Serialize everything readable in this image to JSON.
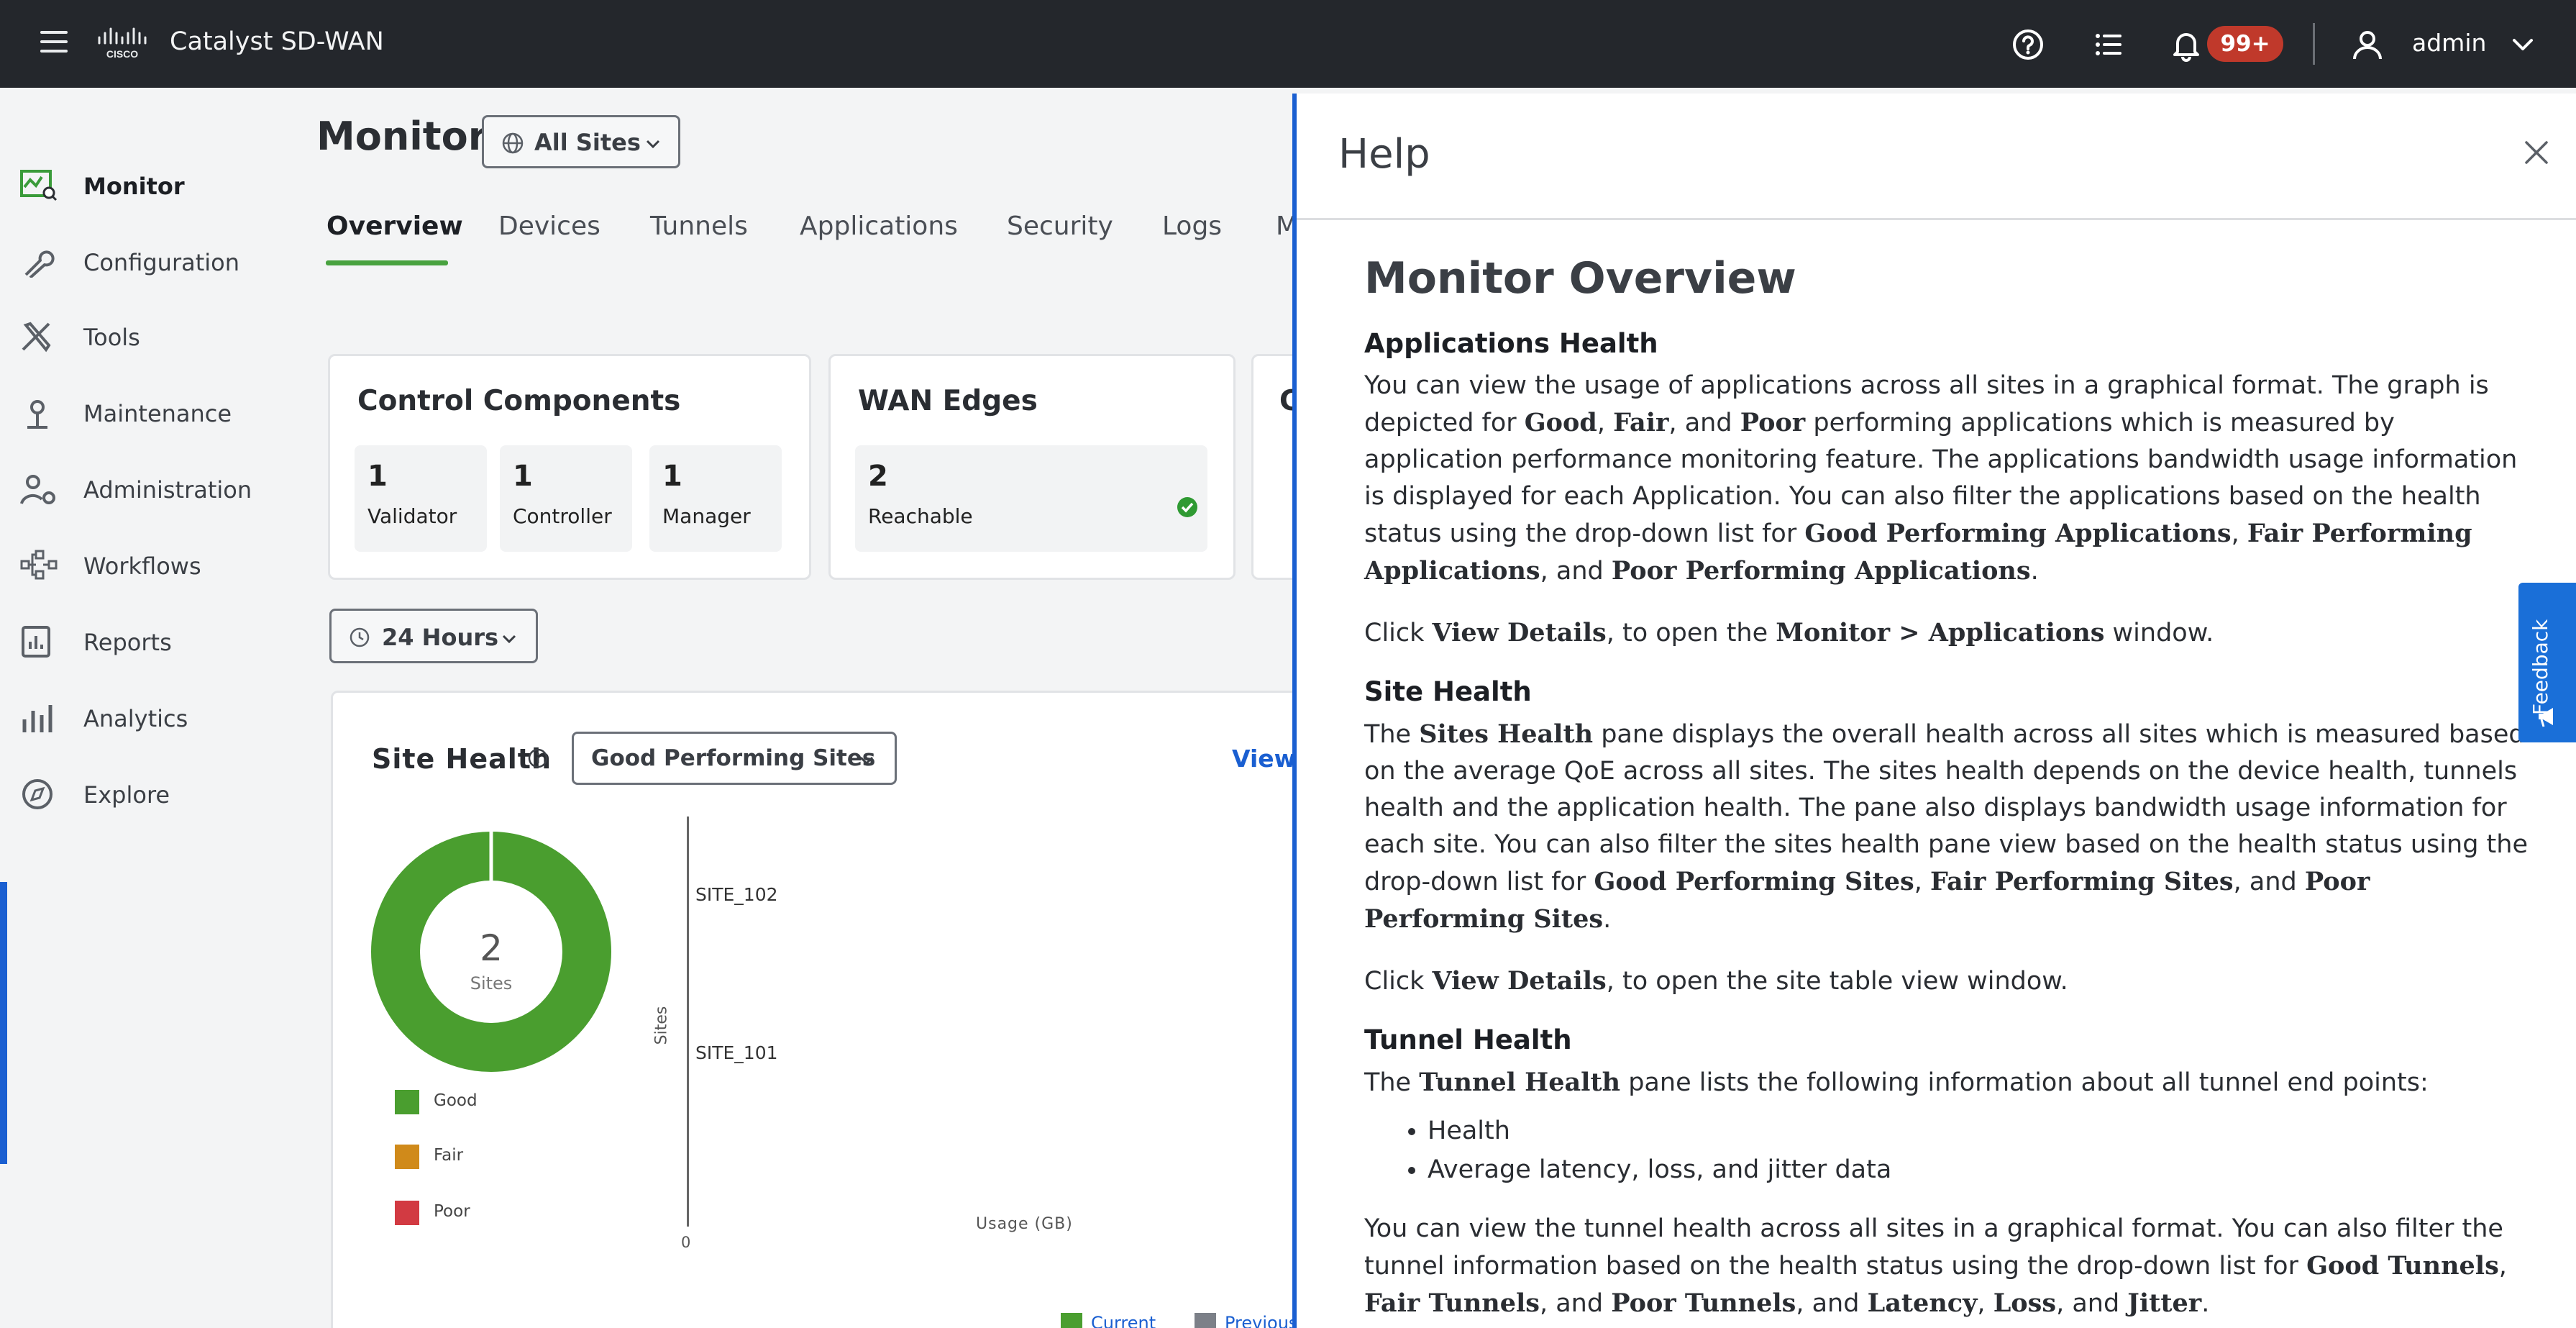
{
  "header": {
    "app_title": "Catalyst SD-WAN",
    "notifications_badge": "99+",
    "user_name": "admin"
  },
  "sidebar": {
    "items": [
      {
        "label": "Monitor",
        "icon": "monitor-icon"
      },
      {
        "label": "Configuration",
        "icon": "wrench-icon"
      },
      {
        "label": "Tools",
        "icon": "tools-icon"
      },
      {
        "label": "Maintenance",
        "icon": "maintenance-icon"
      },
      {
        "label": "Administration",
        "icon": "admin-user-gear-icon"
      },
      {
        "label": "Workflows",
        "icon": "workflows-icon"
      },
      {
        "label": "Reports",
        "icon": "reports-icon"
      },
      {
        "label": "Analytics",
        "icon": "bar-chart-icon"
      },
      {
        "label": "Explore",
        "icon": "compass-icon"
      }
    ]
  },
  "main": {
    "page_title": "Monitor",
    "site_filter": "All Sites",
    "tabs": [
      "Overview",
      "Devices",
      "Tunnels",
      "Applications",
      "Security",
      "Logs",
      "M"
    ],
    "control_components": {
      "title": "Control Components",
      "stats": [
        {
          "value": "1",
          "label": "Validator"
        },
        {
          "value": "1",
          "label": "Controller"
        },
        {
          "value": "1",
          "label": "Manager"
        }
      ]
    },
    "wan_edges": {
      "title": "WAN Edges",
      "value": "2",
      "label": "Reachable"
    },
    "third_card_title_fragment": "C",
    "time_filter": "24 Hours",
    "site_health": {
      "title": "Site Health",
      "filter": "Good Performing Sites",
      "view_link": "View D",
      "donut_value": "2",
      "donut_label": "Sites",
      "legend": [
        "Good",
        "Fair",
        "Poor"
      ],
      "colors": {
        "good": "#4a9e2f",
        "fair": "#d08a1a",
        "poor": "#d23a42"
      },
      "y_axis_label": "Sites",
      "x_axis_label": "Usage (GB)",
      "x_zero": "0",
      "sites": [
        "SITE_102",
        "SITE_101"
      ],
      "bottom_legend": [
        "Current",
        "Previous"
      ]
    }
  },
  "help": {
    "title": "Help",
    "heading": "Monitor Overview",
    "sections": {
      "apps_title": "Applications Health",
      "apps_p1_a": "You can view the usage of applications across all sites in a graphical format. The graph is depicted for ",
      "apps_good": "Good",
      "apps_sep1": ", ",
      "apps_fair": "Fair",
      "apps_sep2": ", and ",
      "apps_poor": "Poor",
      "apps_p1_b": " performing applications which is measured by application performance monitoring feature. The applications bandwidth usage information is displayed for each Application. You can also filter the applications based on the health status using the drop-down list for ",
      "apps_gpa": "Good Performing Applications",
      "apps_sep3": ", ",
      "apps_fpa": "Fair Performing Applications",
      "apps_sep4": ", and ",
      "apps_ppa": "Poor Performing Applications",
      "apps_end": ".",
      "apps_p2_a": "Click ",
      "apps_view": "View Details",
      "apps_p2_b": ", to open the ",
      "apps_window": "Monitor > Applications",
      "apps_p2_c": " window.",
      "site_title": "Site Health",
      "site_p1_a": "The ",
      "site_pane": "Sites Health",
      "site_p1_b": " pane displays the overall health across all sites which is measured based on the average QoE across all sites. The sites health depends on the device health, tunnels health and the application health. The pane also displays bandwidth usage information for each site. You can also filter the sites health pane view based on the health status using the drop-down list for ",
      "site_gps": "Good Performing Sites",
      "site_sep1": ", ",
      "site_fps": "Fair Performing Sites",
      "site_sep2": ", and ",
      "site_pps": "Poor Performing Sites",
      "site_end": ".",
      "site_p2_a": "Click ",
      "site_view": "View Details",
      "site_p2_b": ", to open the site table view window.",
      "tunnel_title": "Tunnel Health",
      "tunnel_p1_a": "The ",
      "tunnel_pane": "Tunnel Health",
      "tunnel_p1_b": " pane lists the following information about all tunnel end points:",
      "tunnel_bullets": [
        "Health",
        "Average latency, loss, and jitter data"
      ],
      "tunnel_p2_a": "You can view the tunnel health across all sites in a graphical format. You can also filter the tunnel information based on the health status using the drop-down list for ",
      "tunnel_good": "Good Tunnels",
      "tunnel_sep1": ", ",
      "tunnel_fair": "Fair Tunnels",
      "tunnel_sep2": ", and ",
      "tunnel_poor": "Poor Tunnels",
      "tunnel_sep3": ", and ",
      "tunnel_lat": "Latency",
      "tunnel_sep4": ", ",
      "tunnel_loss": "Loss",
      "tunnel_sep5": ", and ",
      "tunnel_jit": "Jitter",
      "tunnel_end": "."
    },
    "feedback_label": "Feedback"
  }
}
